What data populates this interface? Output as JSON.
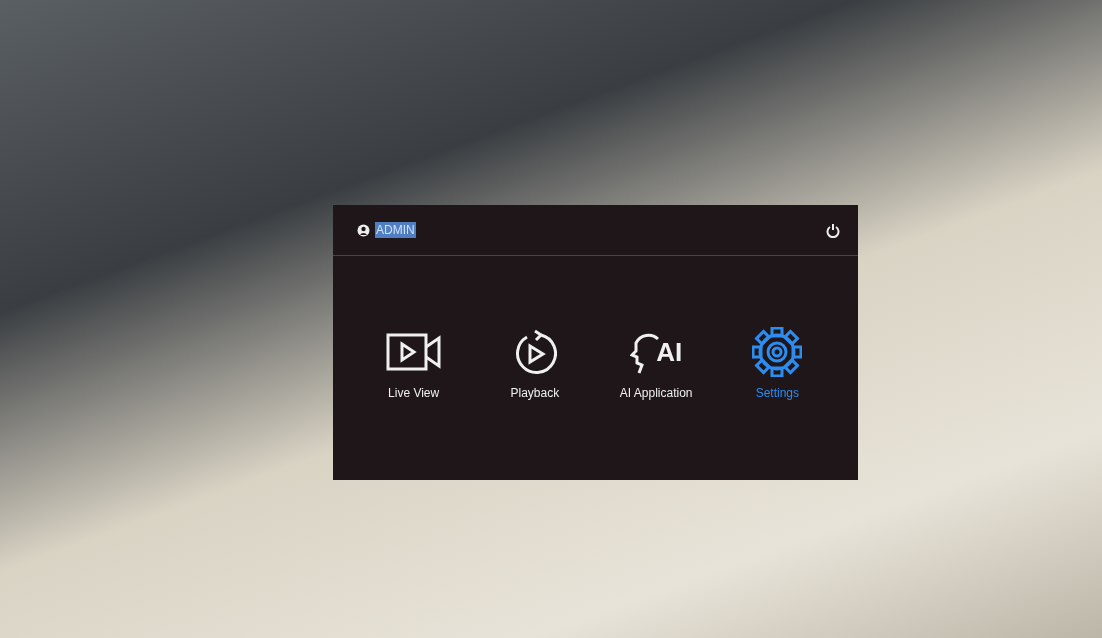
{
  "user": {
    "name": "ADMIN",
    "highlighted": true
  },
  "menu": [
    {
      "kind": "live",
      "label": "Live View",
      "selected": false
    },
    {
      "kind": "playback",
      "label": "Playback",
      "selected": false
    },
    {
      "kind": "ai",
      "label": "AI Application",
      "badge": "AI",
      "selected": false
    },
    {
      "kind": "settings",
      "label": "Settings",
      "selected": true
    }
  ]
}
